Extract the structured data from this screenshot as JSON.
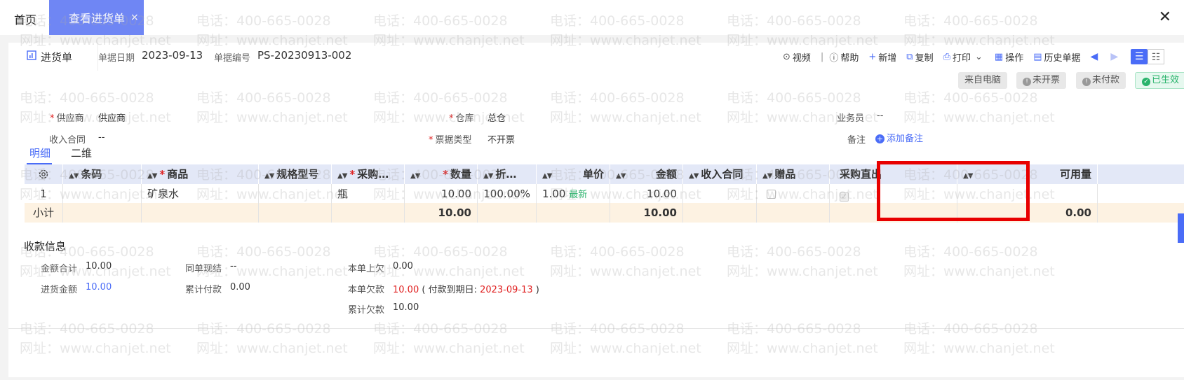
{
  "tabs": {
    "home": "首页",
    "active": "查看进货单",
    "close_glyph": "×"
  },
  "window": {
    "close_glyph": "✕"
  },
  "doc": {
    "tab_label": "进货单",
    "date_label": "单据日期",
    "date_value": "2023-09-13",
    "number_label": "单据编号",
    "number_value": "PS-20230913-002"
  },
  "toolbar": {
    "video": "视频",
    "sep": "|",
    "help": "帮助",
    "add": "新增",
    "copy": "复制",
    "print": "打印",
    "operate": "操作",
    "history": "历史单据"
  },
  "badges": {
    "source": "来自电脑",
    "invoice": "未开票",
    "payment": "未付款",
    "effective": "已生效"
  },
  "form": {
    "supplier_label": "供应商",
    "supplier_value": "供应商",
    "warehouse_label": "仓库",
    "warehouse_value": "总仓",
    "salesman_label": "业务员",
    "salesman_value": "--",
    "contract_label": "收入合同",
    "contract_value": "--",
    "invoice_type_label": "票据类型",
    "invoice_type_value": "不开票",
    "note_label": "备注",
    "note_add": "添加备注"
  },
  "subtabs": [
    "明细",
    "二维"
  ],
  "grid": {
    "headers": {
      "barcode": "条码",
      "product": "商品",
      "spec": "规格型号",
      "unit": "采购…",
      "qty": "数量",
      "discount": "折…",
      "price": "单价",
      "amount": "金额",
      "contract": "收入合同",
      "gift": "赠品",
      "direct": "采购直出",
      "available": "可用量"
    },
    "row": {
      "no": "1",
      "product": "矿泉水",
      "unit": "瓶",
      "qty": "10.00",
      "discount": "100.00%",
      "price": "1.00",
      "price_tag": "最新",
      "amount": "10.00",
      "gift": false,
      "direct": true
    },
    "subtotal": {
      "label": "小计",
      "qty": "10.00",
      "amount": "10.00",
      "available": "0.00"
    }
  },
  "payment": {
    "title": "收款信息",
    "total_label": "金额合计",
    "total_value": "10.00",
    "same_label": "同单现结",
    "same_value": "--",
    "prev_owe_label": "本单上欠",
    "prev_owe_value": "0.00",
    "purchase_label": "进货金额",
    "purchase_value": "10.00",
    "paid_label": "累计付款",
    "paid_value": "0.00",
    "owe_label": "本单欠款",
    "owe_value": "10.00",
    "due_open": "( 付款到期日:",
    "due_date": "2023-09-13",
    "due_close": ")",
    "cum_owe_label": "累计欠款",
    "cum_owe_value": "10.00"
  },
  "watermark": {
    "phone": "电话：400-665-0028",
    "site": "网址：www.chanjet.net"
  }
}
